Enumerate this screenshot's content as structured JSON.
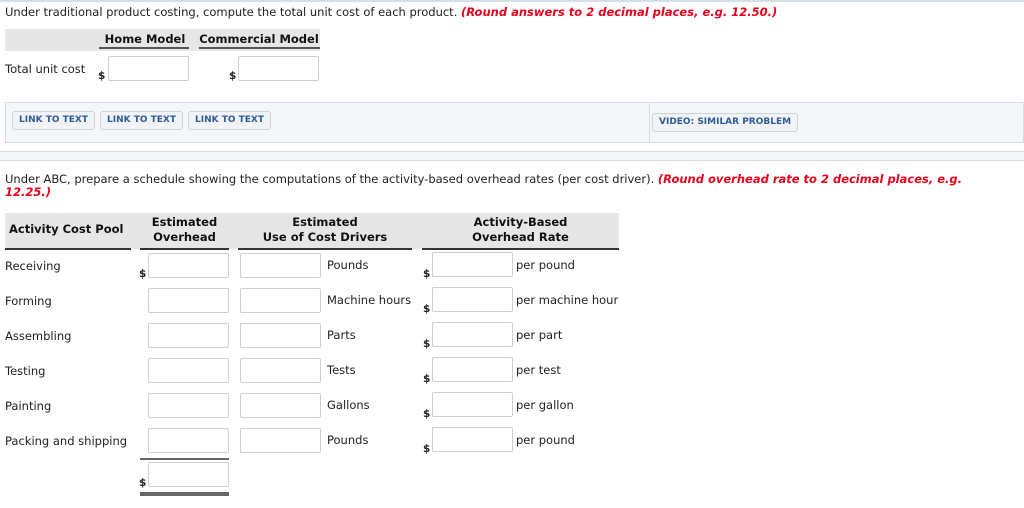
{
  "part1": {
    "instruction": "Under traditional product costing, compute the total unit cost of each product.",
    "round_note": "(Round answers to 2 decimal places, e.g. 12.50.)",
    "columns": [
      "Home Model",
      "Commercial Model"
    ],
    "row_label": "Total unit cost",
    "currency_symbol": "$",
    "values": {
      "home_model": "",
      "commercial_model": ""
    }
  },
  "links": {
    "buttons": [
      "LINK TO TEXT",
      "LINK TO TEXT",
      "LINK TO TEXT"
    ],
    "video_button": "VIDEO: SIMILAR PROBLEM"
  },
  "part2": {
    "instruction": "Under ABC, prepare a schedule showing the computations of the activity-based overhead rates (per cost driver).",
    "round_note_line1": "(Round overhead rate to 2 decimal places, e.g.",
    "round_note_line2": "12.25.)",
    "headers": {
      "pool": "Activity Cost Pool",
      "overhead_line1": "Estimated",
      "overhead_line2": "Overhead",
      "drivers_line1": "Estimated",
      "drivers_line2": "Use of Cost Drivers",
      "rate_line1": "Activity-Based",
      "rate_line2": "Overhead Rate"
    },
    "currency_symbol": "$",
    "rows": [
      {
        "pool": "Receiving",
        "driver": "Pounds",
        "unit": "per pound",
        "overhead": "",
        "usage": "",
        "rate": ""
      },
      {
        "pool": "Forming",
        "driver": "Machine hours",
        "unit": "per machine hour",
        "overhead": "",
        "usage": "",
        "rate": ""
      },
      {
        "pool": "Assembling",
        "driver": "Parts",
        "unit": "per part",
        "overhead": "",
        "usage": "",
        "rate": ""
      },
      {
        "pool": "Testing",
        "driver": "Tests",
        "unit": "per test",
        "overhead": "",
        "usage": "",
        "rate": ""
      },
      {
        "pool": "Painting",
        "driver": "Gallons",
        "unit": "per gallon",
        "overhead": "",
        "usage": "",
        "rate": ""
      },
      {
        "pool": "Packing and shipping",
        "driver": "Pounds",
        "unit": "per pound",
        "overhead": "",
        "usage": "",
        "rate": ""
      }
    ],
    "total_overhead": ""
  }
}
